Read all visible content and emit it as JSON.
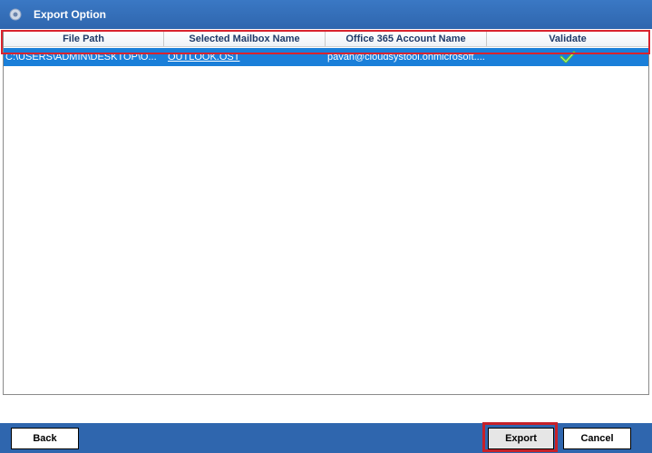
{
  "window": {
    "title": "Export Option"
  },
  "grid": {
    "columns": [
      "File Path",
      "Selected Mailbox Name",
      "Office 365 Account Name",
      "Validate"
    ],
    "rows": [
      {
        "file_path": "C:\\USERS\\ADMIN\\DESKTOP\\O...",
        "mailbox": "OUTLOOK.OST",
        "account": "pavan@cloudsystool.onmicrosoft....",
        "validate_icon": "check-icon"
      }
    ]
  },
  "buttons": {
    "back": "Back",
    "export": "Export",
    "cancel": "Cancel"
  },
  "colors": {
    "titlebar": "#2f66ae",
    "selection": "#1a7fd9",
    "highlight": "#d9232e",
    "check": "#5cc12f"
  }
}
